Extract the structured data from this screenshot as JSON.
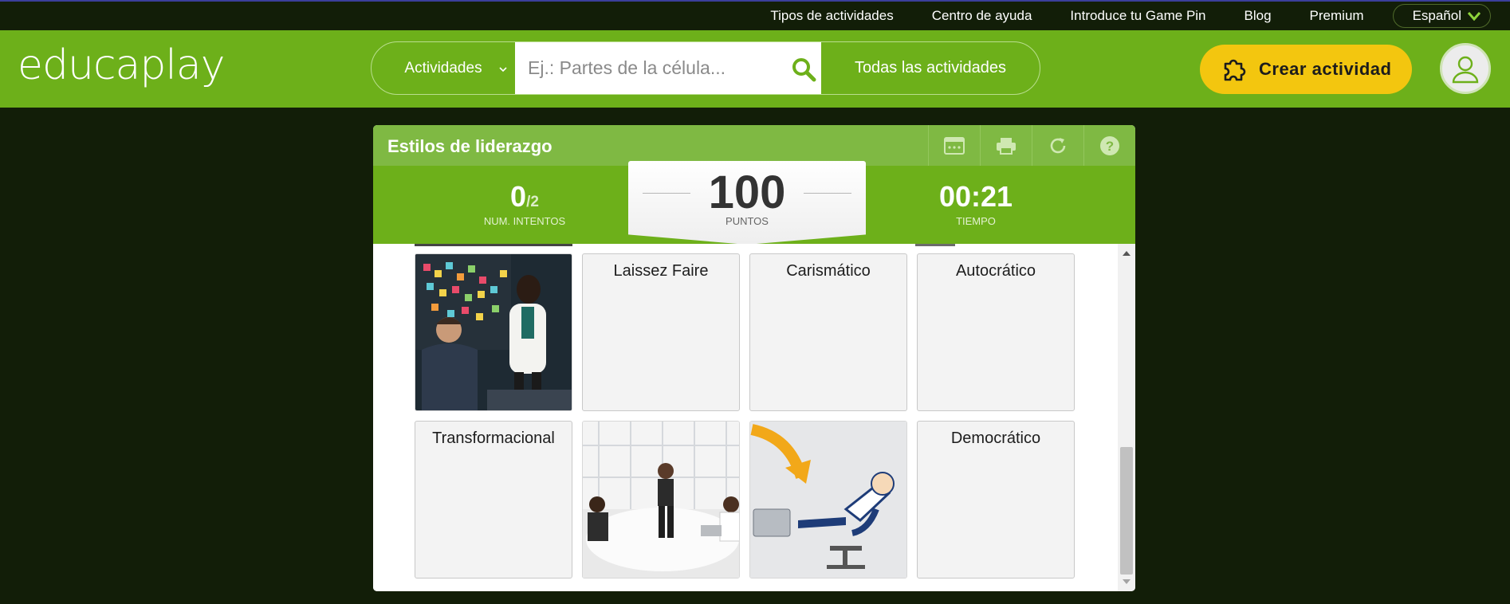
{
  "top_nav": {
    "links": [
      "Tipos de actividades",
      "Centro de ayuda",
      "Introduce tu Game Pin",
      "Blog",
      "Premium"
    ],
    "language": "Español"
  },
  "header": {
    "logo_text": "educaplay",
    "search": {
      "category": "Actividades",
      "placeholder": "Ej.: Partes de la célula...",
      "value": "",
      "all_label": "Todas las actividades"
    },
    "create_button": "Crear actividad"
  },
  "activity": {
    "title": "Estilos de liderazgo",
    "attempts": "0",
    "attempts_total": "/2",
    "attempts_label": "NUM. INTENTOS",
    "points": "100",
    "points_label": "PUNTOS",
    "time": "00:21",
    "time_label": "TIEMPO",
    "cards": [
      {
        "type": "image",
        "icon": "presentation-meeting-photo"
      },
      {
        "type": "text",
        "label": "Laissez Faire"
      },
      {
        "type": "text",
        "label": "Carismático"
      },
      {
        "type": "text",
        "label": "Autocrático"
      },
      {
        "type": "text",
        "label": "Transformacional"
      },
      {
        "type": "image",
        "icon": "office-meeting-photo"
      },
      {
        "type": "image",
        "icon": "relaxed-businessman-illustration"
      },
      {
        "type": "text",
        "label": "Democrático"
      }
    ]
  },
  "colors": {
    "page_bg": "#121e08",
    "brand_green": "#6db01a",
    "title_green": "#7fb943",
    "create_yellow": "#f3c60f"
  }
}
